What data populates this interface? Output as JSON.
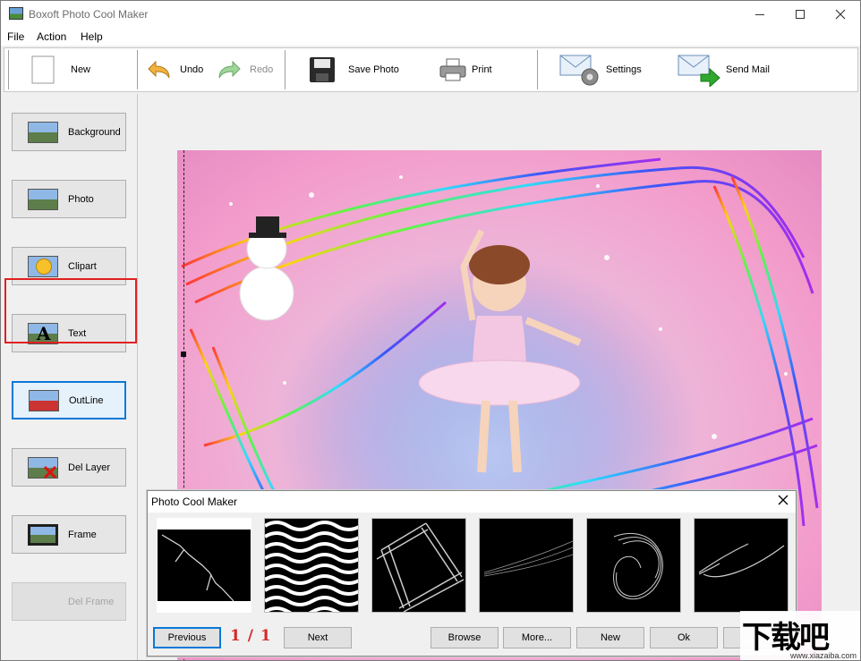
{
  "window": {
    "title": "Boxoft Photo Cool Maker"
  },
  "menu": [
    "File",
    "Action",
    "Help"
  ],
  "toolbar": {
    "new_label": "New",
    "undo_label": "Undo",
    "redo_label": "Redo",
    "save_label": "Save Photo",
    "print_label": "Print",
    "settings_label": "Settings",
    "sendmail_label": "Send Mail"
  },
  "sidebar": {
    "items": [
      {
        "label": "Background"
      },
      {
        "label": "Photo"
      },
      {
        "label": "Clipart"
      },
      {
        "label": "Text"
      },
      {
        "label": "OutLine"
      },
      {
        "label": "Del Layer"
      },
      {
        "label": "Frame"
      },
      {
        "label": "Del Frame"
      }
    ],
    "active": "OutLine",
    "disabled": [
      "Del Frame"
    ]
  },
  "dialog": {
    "title": "Photo Cool Maker",
    "page_indicator": "1 / 1",
    "buttons": {
      "previous": "Previous",
      "next": "Next",
      "browse": "Browse",
      "more": "More...",
      "new": "New",
      "ok": "Ok"
    },
    "thumbnails": [
      "lightning-outline",
      "waves-outline",
      "tangled-frame-outline",
      "light-streak-outline",
      "swirl-outline",
      "curve-outline"
    ]
  },
  "watermark": {
    "main": "下载吧",
    "sub": "www.xiazaiba.com"
  },
  "colors": {
    "accent": "#0a78d7",
    "highlight": "#e02020",
    "page_indicator": "#d42a2a"
  }
}
